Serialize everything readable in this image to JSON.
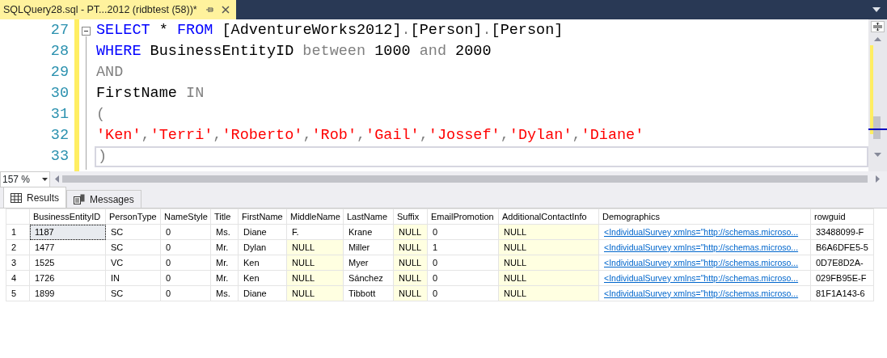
{
  "document_tab": {
    "title": "SQLQuery28.sql - PT...2012 (ridbtest (58))*",
    "selected": true
  },
  "editor": {
    "lines": [
      {
        "number": "27",
        "current": false,
        "collapsible": true,
        "tokens": [
          {
            "text": "SELECT",
            "kind": "keyword"
          },
          {
            "text": " * ",
            "kind": "plain"
          },
          {
            "text": "FROM",
            "kind": "keyword"
          },
          {
            "text": " [AdventureWorks2012]",
            "kind": "plain"
          },
          {
            "text": ".",
            "kind": "operator"
          },
          {
            "text": "[Person]",
            "kind": "plain"
          },
          {
            "text": ".",
            "kind": "operator"
          },
          {
            "text": "[Person]",
            "kind": "plain"
          }
        ]
      },
      {
        "number": "28",
        "current": false,
        "collapsible": false,
        "tokens": [
          {
            "text": "WHERE",
            "kind": "keyword"
          },
          {
            "text": " BusinessEntityID ",
            "kind": "plain"
          },
          {
            "text": "between",
            "kind": "operator"
          },
          {
            "text": " 1000 ",
            "kind": "plain"
          },
          {
            "text": "and",
            "kind": "operator"
          },
          {
            "text": " 2000",
            "kind": "plain"
          }
        ]
      },
      {
        "number": "29",
        "current": false,
        "collapsible": false,
        "tokens": [
          {
            "text": "AND",
            "kind": "operator"
          }
        ]
      },
      {
        "number": "30",
        "current": false,
        "collapsible": false,
        "tokens": [
          {
            "text": "FirstName ",
            "kind": "plain"
          },
          {
            "text": "IN",
            "kind": "operator"
          }
        ]
      },
      {
        "number": "31",
        "current": false,
        "collapsible": false,
        "tokens": [
          {
            "text": "(",
            "kind": "operator"
          }
        ]
      },
      {
        "number": "32",
        "current": false,
        "collapsible": false,
        "tokens": [
          {
            "text": "'Ken'",
            "kind": "string"
          },
          {
            "text": ",",
            "kind": "operator"
          },
          {
            "text": "'Terri'",
            "kind": "string"
          },
          {
            "text": ",",
            "kind": "operator"
          },
          {
            "text": "'Roberto'",
            "kind": "string"
          },
          {
            "text": ",",
            "kind": "operator"
          },
          {
            "text": "'Rob'",
            "kind": "string"
          },
          {
            "text": ",",
            "kind": "operator"
          },
          {
            "text": "'Gail'",
            "kind": "string"
          },
          {
            "text": ",",
            "kind": "operator"
          },
          {
            "text": "'Jossef'",
            "kind": "string"
          },
          {
            "text": ",",
            "kind": "operator"
          },
          {
            "text": "'Dylan'",
            "kind": "string"
          },
          {
            "text": ",",
            "kind": "operator"
          },
          {
            "text": "'Diane'",
            "kind": "string"
          }
        ]
      },
      {
        "number": "33",
        "current": true,
        "collapsible": false,
        "tokens": [
          {
            "text": ")",
            "kind": "operator"
          }
        ]
      }
    ]
  },
  "zoom": {
    "value": "157 %"
  },
  "result_tabs": [
    {
      "label": "Results",
      "selected": true,
      "kind": "grid"
    },
    {
      "label": "Messages",
      "selected": false,
      "kind": "messages"
    }
  ],
  "grid": {
    "columns": [
      "BusinessEntityID",
      "PersonType",
      "NameStyle",
      "Title",
      "FirstName",
      "MiddleName",
      "LastName",
      "Suffix",
      "EmailPromotion",
      "AdditionalContactInfo",
      "Demographics",
      "rowguid"
    ],
    "rows": [
      {
        "number": "1",
        "cells": [
          {
            "text": "1187",
            "kind": "text",
            "selected": true
          },
          {
            "text": "SC",
            "kind": "text",
            "selected": false
          },
          {
            "text": "0",
            "kind": "text",
            "selected": false
          },
          {
            "text": "Ms.",
            "kind": "text",
            "selected": false
          },
          {
            "text": "Diane",
            "kind": "text",
            "selected": false
          },
          {
            "text": "F.",
            "kind": "text",
            "selected": false
          },
          {
            "text": "Krane",
            "kind": "text",
            "selected": false
          },
          {
            "text": "NULL",
            "kind": "null",
            "selected": false
          },
          {
            "text": "0",
            "kind": "text",
            "selected": false
          },
          {
            "text": "NULL",
            "kind": "null",
            "selected": false
          },
          {
            "text": "<IndividualSurvey xmlns=\"http://schemas.microso...",
            "kind": "link",
            "selected": false
          },
          {
            "text": "33488099-F",
            "kind": "text",
            "selected": false
          }
        ]
      },
      {
        "number": "2",
        "cells": [
          {
            "text": "1477",
            "kind": "text",
            "selected": false
          },
          {
            "text": "SC",
            "kind": "text",
            "selected": false
          },
          {
            "text": "0",
            "kind": "text",
            "selected": false
          },
          {
            "text": "Mr.",
            "kind": "text",
            "selected": false
          },
          {
            "text": "Dylan",
            "kind": "text",
            "selected": false
          },
          {
            "text": "NULL",
            "kind": "null",
            "selected": false
          },
          {
            "text": "Miller",
            "kind": "text",
            "selected": false
          },
          {
            "text": "NULL",
            "kind": "null",
            "selected": false
          },
          {
            "text": "1",
            "kind": "text",
            "selected": false
          },
          {
            "text": "NULL",
            "kind": "null",
            "selected": false
          },
          {
            "text": "<IndividualSurvey xmlns=\"http://schemas.microso...",
            "kind": "link",
            "selected": false
          },
          {
            "text": "B6A6DFE5-5",
            "kind": "text",
            "selected": false
          }
        ]
      },
      {
        "number": "3",
        "cells": [
          {
            "text": "1525",
            "kind": "text",
            "selected": false
          },
          {
            "text": "VC",
            "kind": "text",
            "selected": false
          },
          {
            "text": "0",
            "kind": "text",
            "selected": false
          },
          {
            "text": "Mr.",
            "kind": "text",
            "selected": false
          },
          {
            "text": "Ken",
            "kind": "text",
            "selected": false
          },
          {
            "text": "NULL",
            "kind": "null",
            "selected": false
          },
          {
            "text": "Myer",
            "kind": "text",
            "selected": false
          },
          {
            "text": "NULL",
            "kind": "null",
            "selected": false
          },
          {
            "text": "0",
            "kind": "text",
            "selected": false
          },
          {
            "text": "NULL",
            "kind": "null",
            "selected": false
          },
          {
            "text": "<IndividualSurvey xmlns=\"http://schemas.microso...",
            "kind": "link",
            "selected": false
          },
          {
            "text": "0D7E8D2A-",
            "kind": "text",
            "selected": false
          }
        ]
      },
      {
        "number": "4",
        "cells": [
          {
            "text": "1726",
            "kind": "text",
            "selected": false
          },
          {
            "text": "IN",
            "kind": "text",
            "selected": false
          },
          {
            "text": "0",
            "kind": "text",
            "selected": false
          },
          {
            "text": "Mr.",
            "kind": "text",
            "selected": false
          },
          {
            "text": "Ken",
            "kind": "text",
            "selected": false
          },
          {
            "text": "NULL",
            "kind": "null",
            "selected": false
          },
          {
            "text": "Sánchez",
            "kind": "text",
            "selected": false
          },
          {
            "text": "NULL",
            "kind": "null",
            "selected": false
          },
          {
            "text": "0",
            "kind": "text",
            "selected": false
          },
          {
            "text": "NULL",
            "kind": "null",
            "selected": false
          },
          {
            "text": "<IndividualSurvey xmlns=\"http://schemas.microso...",
            "kind": "link",
            "selected": false
          },
          {
            "text": "029FB95E-F",
            "kind": "text",
            "selected": false
          }
        ]
      },
      {
        "number": "5",
        "cells": [
          {
            "text": "1899",
            "kind": "text",
            "selected": false
          },
          {
            "text": "SC",
            "kind": "text",
            "selected": false
          },
          {
            "text": "0",
            "kind": "text",
            "selected": false
          },
          {
            "text": "Ms.",
            "kind": "text",
            "selected": false
          },
          {
            "text": "Diane",
            "kind": "text",
            "selected": false
          },
          {
            "text": "NULL",
            "kind": "null",
            "selected": false
          },
          {
            "text": "Tibbott",
            "kind": "text",
            "selected": false
          },
          {
            "text": "NULL",
            "kind": "null",
            "selected": false
          },
          {
            "text": "0",
            "kind": "text",
            "selected": false
          },
          {
            "text": "NULL",
            "kind": "null",
            "selected": false
          },
          {
            "text": "<IndividualSurvey xmlns=\"http://schemas.microso...",
            "kind": "link",
            "selected": false
          },
          {
            "text": "81F1A143-6",
            "kind": "text",
            "selected": false
          }
        ]
      }
    ]
  }
}
